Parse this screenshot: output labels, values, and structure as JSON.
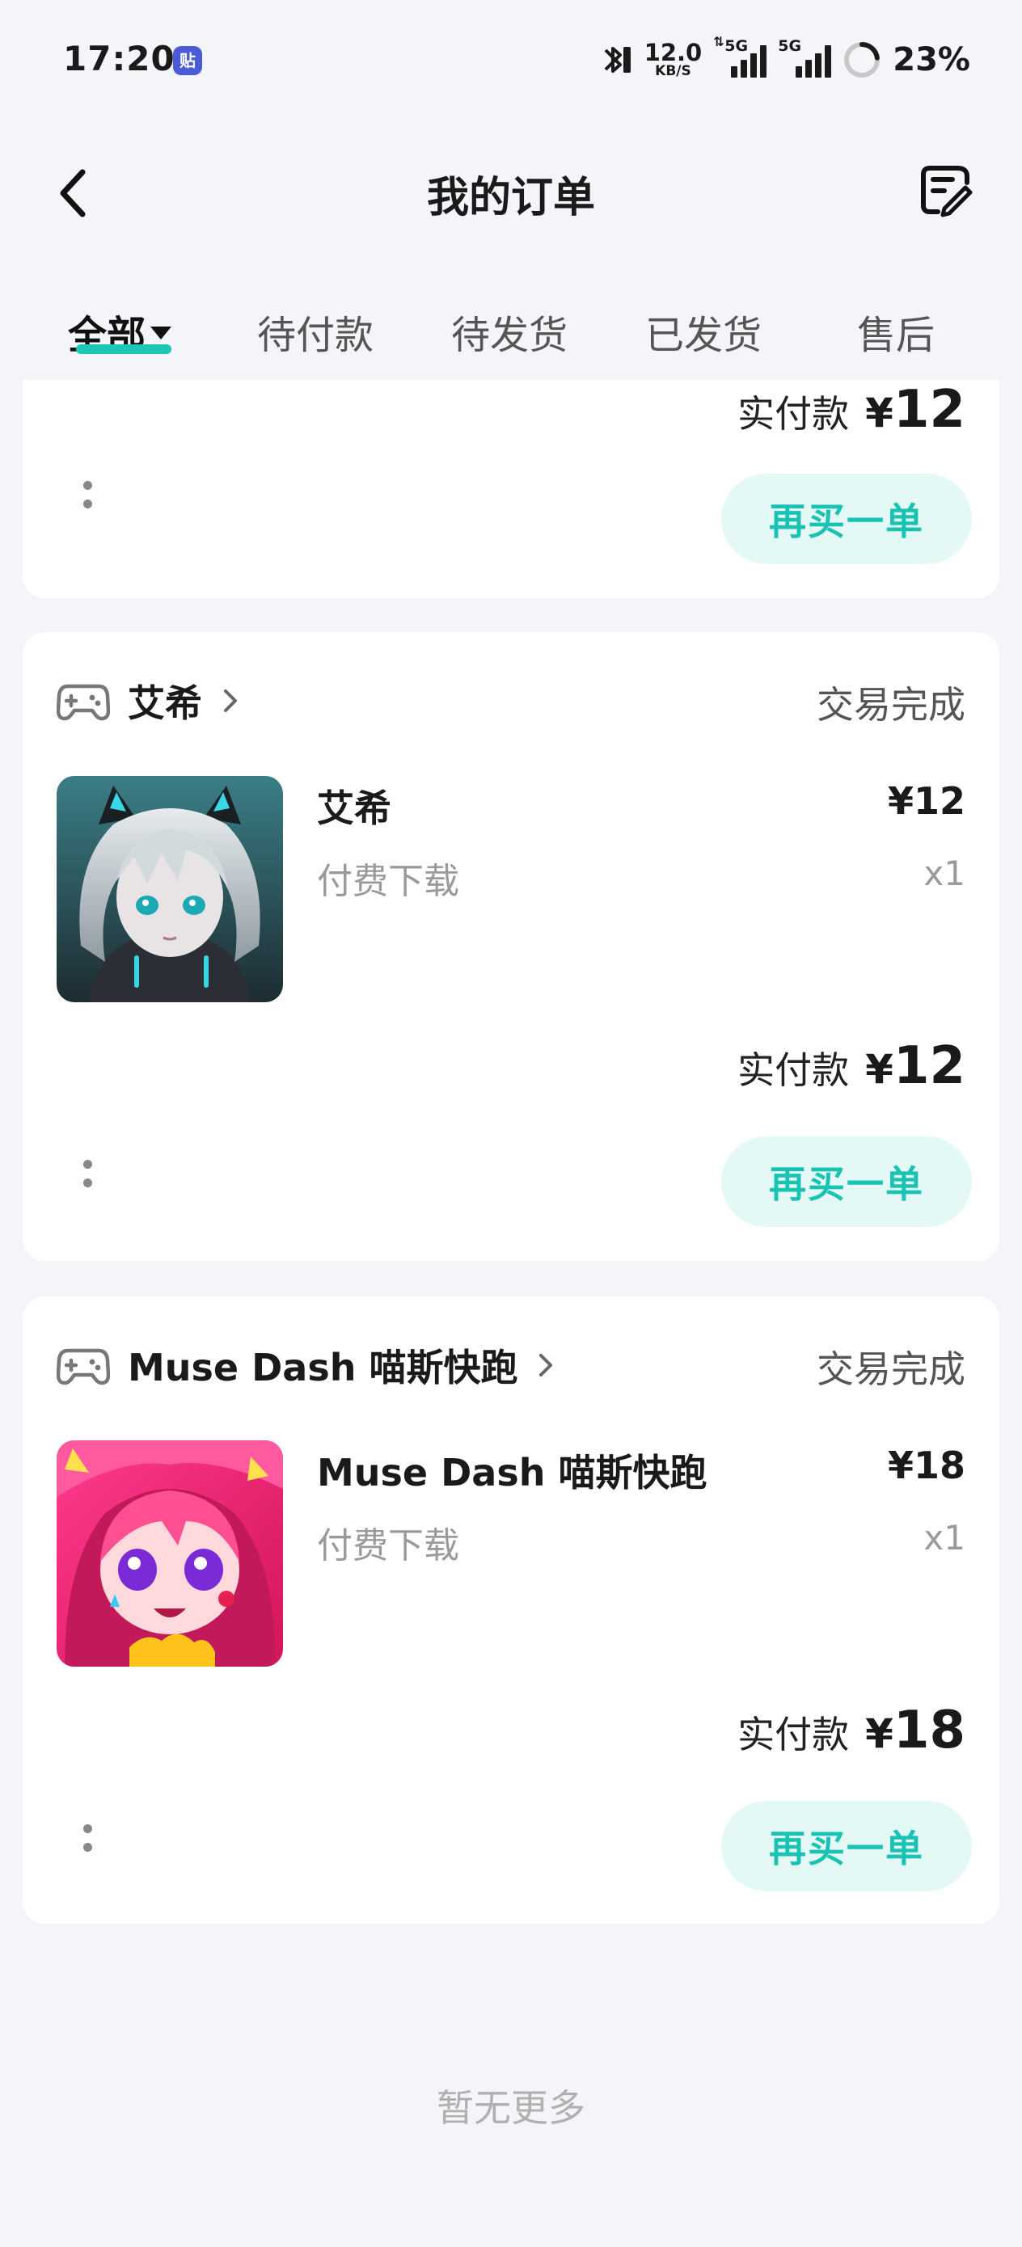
{
  "status_bar": {
    "time": "17:20",
    "app_badge": "贴",
    "net_speed_value": "12.0",
    "net_speed_unit": "KB/S",
    "signal_1": "5G",
    "signal_2": "5G",
    "battery": "23%",
    "battery_level": 0.23
  },
  "header": {
    "title": "我的订单",
    "back_icon": "chevron-left-icon",
    "edit_icon": "order-edit-icon"
  },
  "tabs": [
    {
      "label": "全部",
      "active": true
    },
    {
      "label": "待付款",
      "active": false
    },
    {
      "label": "待发货",
      "active": false
    },
    {
      "label": "已发货",
      "active": false
    },
    {
      "label": "售后",
      "active": false
    }
  ],
  "orders": [
    {
      "paid_label": "实付款",
      "paid_currency": "¥",
      "paid_amount": "12",
      "action": "再买一单"
    },
    {
      "store": "艾希",
      "status": "交易完成",
      "product_name": "艾希",
      "product_type": "付费下载",
      "price": "¥12",
      "qty": "x1",
      "paid_label": "实付款",
      "paid_currency": "¥",
      "paid_amount": "12",
      "action": "再买一单"
    },
    {
      "store": "Muse Dash 喵斯快跑",
      "status": "交易完成",
      "product_name": "Muse Dash 喵斯快跑",
      "product_type": "付费下载",
      "price": "¥18",
      "qty": "x1",
      "paid_label": "实付款",
      "paid_currency": "¥",
      "paid_amount": "18",
      "action": "再买一单"
    }
  ],
  "footer": {
    "no_more": "暂无更多"
  },
  "colors": {
    "accent": "#1cc7b8",
    "button_bg": "#e4f8f6",
    "page_bg": "#f4f5f9"
  }
}
